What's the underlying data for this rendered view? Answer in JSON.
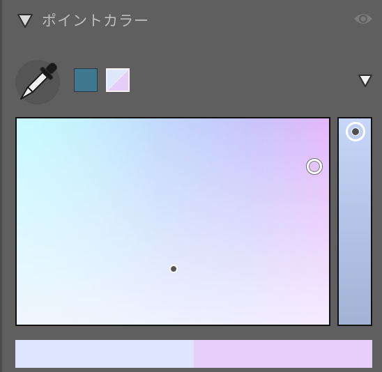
{
  "panel": {
    "title": "ポイントカラー"
  },
  "icons": {
    "collapse": "triangle-down-icon",
    "visibility": "eye-icon",
    "eyedropper": "eyedropper-icon",
    "menu": "triangle-down-icon"
  },
  "colors": {
    "main_swatch": "#3f778e",
    "sub_swatch_a": "#dfe7fb",
    "sub_swatch_b": "#e6cdf8",
    "previous_color": "#dde6fe",
    "current_color": "#e8cefb",
    "hue_color": "#c8b4fa"
  }
}
